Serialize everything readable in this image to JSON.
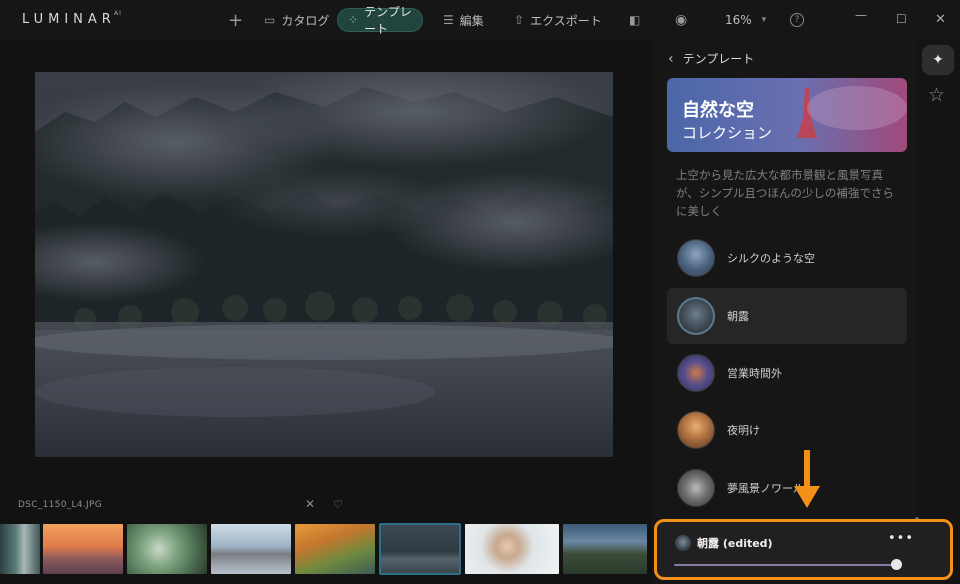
{
  "app": {
    "logo": "LUMINAR",
    "logo_suffix": "AI"
  },
  "toolbar": {
    "add_icon": "plus-icon",
    "catalog": "カタログ",
    "template": "テンプレート",
    "edit": "編集",
    "export": "エクスポート",
    "zoom": "16%",
    "help": "?"
  },
  "window_controls": [
    "minimize",
    "maximize",
    "close"
  ],
  "image": {
    "filename": "DSC_1150_L4.JPG"
  },
  "filmstrip": {
    "count": 8,
    "selected_index": 4
  },
  "panel": {
    "back_label": "テンプレート",
    "banner_line1": "自然な空",
    "banner_line2": "コレクション",
    "description": "上空から見た広大な都市景観と風景写真が、シンプル且つほんの少しの補強でさらに美しく",
    "templates": [
      {
        "label": "シルクのような空",
        "active": false
      },
      {
        "label": "朝露",
        "active": true
      },
      {
        "label": "営業時間外",
        "active": false
      },
      {
        "label": "夜明け",
        "active": false
      },
      {
        "label": "夢風景ノワール",
        "active": false
      }
    ]
  },
  "edited": {
    "label": "朝露 (edited)",
    "more": "•••",
    "amount": 1.0
  },
  "colors": {
    "accent": "#f39018",
    "template_active": "#21443f",
    "slider": "#8a7aa4"
  }
}
